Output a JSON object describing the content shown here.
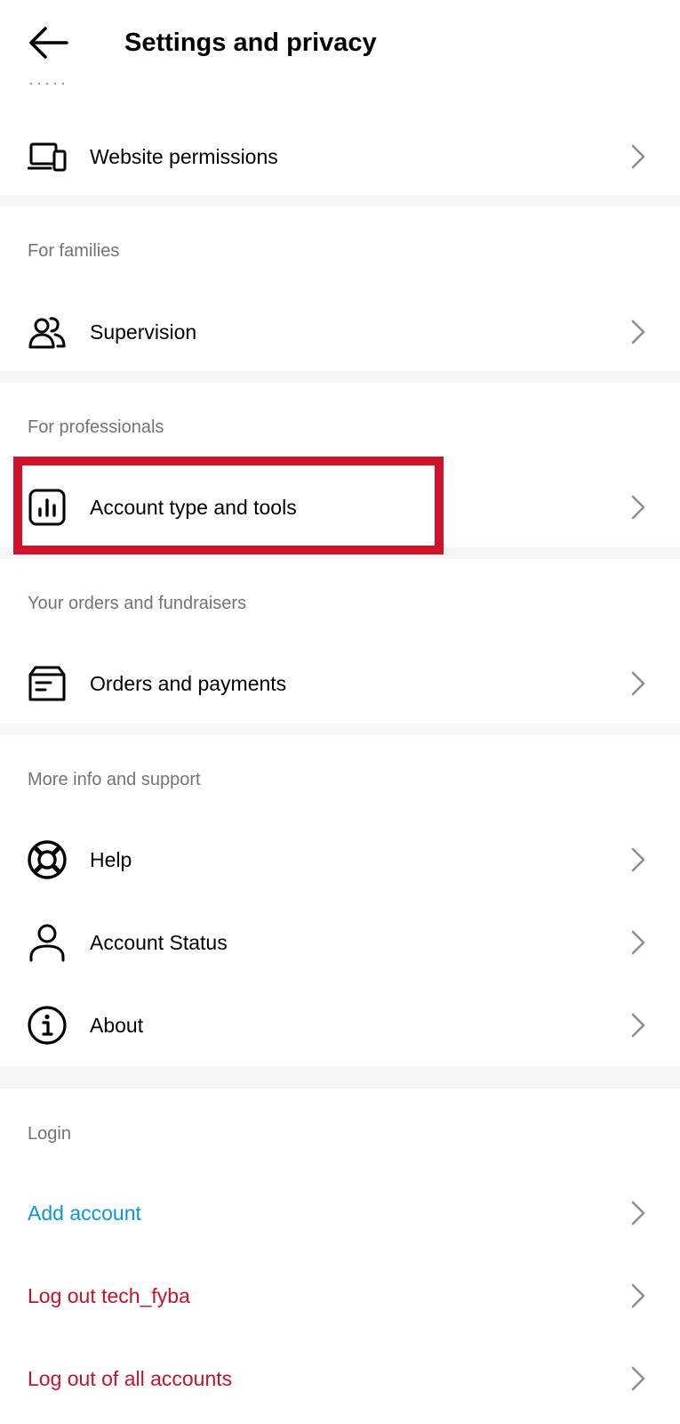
{
  "header": {
    "title": "Settings and privacy"
  },
  "sections": {
    "top": {
      "items": [
        {
          "label": "Website permissions",
          "icon": "devices-icon"
        }
      ]
    },
    "families": {
      "title": "For families",
      "items": [
        {
          "label": "Supervision",
          "icon": "people-icon"
        }
      ]
    },
    "professionals": {
      "title": "For professionals",
      "items": [
        {
          "label": "Account type and tools",
          "icon": "bar-chart-icon"
        }
      ]
    },
    "orders": {
      "title": "Your orders and fundraisers",
      "items": [
        {
          "label": "Orders and payments",
          "icon": "package-icon"
        }
      ]
    },
    "support": {
      "title": "More info and support",
      "items": [
        {
          "label": "Help",
          "icon": "lifebuoy-icon"
        },
        {
          "label": "Account Status",
          "icon": "person-icon"
        },
        {
          "label": "About",
          "icon": "info-icon"
        }
      ]
    },
    "login": {
      "title": "Login",
      "items": [
        {
          "label": "Add account"
        },
        {
          "label": "Log out tech_fyba"
        },
        {
          "label": "Log out of all accounts"
        }
      ]
    }
  },
  "colors": {
    "section_title": "#737373",
    "separator_band": "#f6f6f6",
    "link_blue": "#0a95d6",
    "logout_red": "#c2152d",
    "highlight_red": "#d0122a"
  }
}
